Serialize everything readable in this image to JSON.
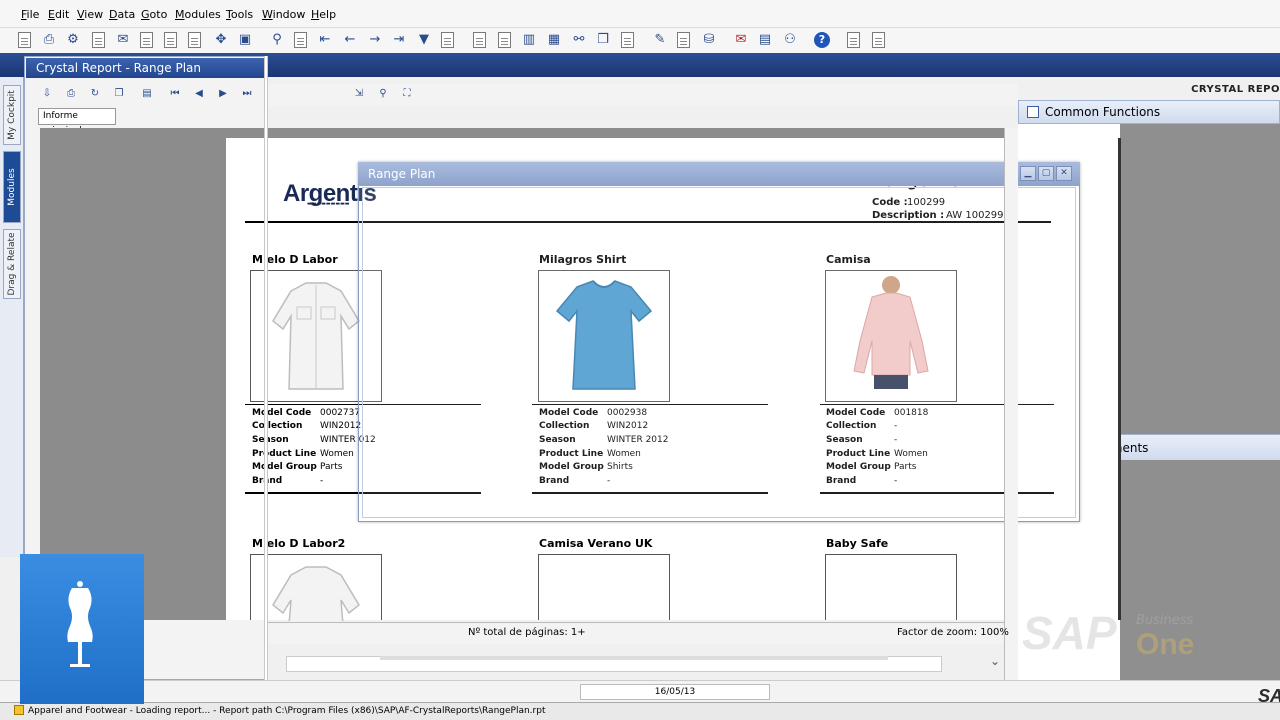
{
  "menu": [
    "File",
    "Edit",
    "View",
    "Data",
    "Goto",
    "Modules",
    "Tools",
    "Window",
    "Help"
  ],
  "side_tabs": [
    "My Cockpit",
    "Modules",
    "Drag & Relate"
  ],
  "crystal_window": {
    "title": "Crystal Report - Range Plan",
    "tab": "Informe principal",
    "brand": "CRYSTAL REPO"
  },
  "common_functions": "Common Functions",
  "documents": "Documents",
  "range_plan_window": {
    "title": "Range Plan"
  },
  "report": {
    "logo": "Argentis",
    "title": "Range Plan",
    "code_label": "Code :",
    "code_value": "100299",
    "description_label": "Description :",
    "description_value": "AW 100299",
    "attr_labels": [
      "Model Code",
      "Collection",
      "Season",
      "Product Line",
      "Model Group",
      "Brand"
    ],
    "products": [
      {
        "name": "M  elo D Labor",
        "model_code": "0002737",
        "collection": "WIN2012",
        "season": "WINTER  012",
        "product_line": "Women",
        "model_group": "Parts",
        "brand": "-"
      },
      {
        "name": "Milagros Shirt",
        "model_code": "0002938",
        "collection": "WIN2012",
        "season": "WINTER 2012",
        "product_line": "Women",
        "model_group": "Shirts",
        "brand": "-"
      },
      {
        "name": "Camisa",
        "model_code": "001818",
        "collection": "-",
        "season": "-",
        "product_line": "Women",
        "model_group": "Parts",
        "brand": "-"
      }
    ],
    "products_row2": [
      "M  elo D Labor2",
      "Camisa Verano UK",
      "Baby Safe"
    ]
  },
  "status": {
    "pages": "Nº total de páginas: 1+",
    "zoom": "Factor de zoom: 100%",
    "date": "16/05/13",
    "main": "Apparel and Footwear - Loading report... - Report path C:\\Program Files (x86)\\SAP\\AF-CrystalReports\\RangePlan.rpt"
  },
  "watermark": {
    "sap": "SAP",
    "business": "Business",
    "one": "One",
    "corner": "SAP"
  },
  "colors": {
    "title_blue": "#22468e",
    "tile_blue": "#2a80d8",
    "report_gray": "#8c8c8c"
  }
}
